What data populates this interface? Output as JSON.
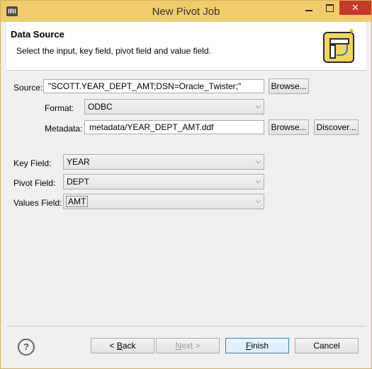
{
  "window": {
    "title": "New Pivot Job",
    "app_icon_text": "IRI",
    "close_glyph": "✕"
  },
  "header": {
    "title": "Data Source",
    "description": "Select the input, key field, pivot field and value field.",
    "icon": "pivot-wizard-icon"
  },
  "source": {
    "label": "Source:",
    "value": "\"SCOTT.YEAR_DEPT_AMT;DSN=Oracle_Twister;\"",
    "browse_label": "Browse..."
  },
  "format": {
    "label": "Format:",
    "value": "ODBC"
  },
  "metadata": {
    "label": "Metadata:",
    "value": "metadata/YEAR_DEPT_AMT.ddf",
    "browse_label": "Browse...",
    "discover_label": "Discover..."
  },
  "key_field": {
    "label": "Key Field:",
    "value": "YEAR"
  },
  "pivot_field": {
    "label": "Pivot Field:",
    "value": "DEPT"
  },
  "values_field": {
    "label": "Values Field:",
    "value": "AMT"
  },
  "buttons": {
    "back_mnemonic": "B",
    "back_rest": "ack",
    "back_prefix": "< ",
    "next_prefix": "",
    "next_mnemonic": "N",
    "next_rest": "ext >",
    "finish_mnemonic": "F",
    "finish_rest": "inish",
    "cancel": "Cancel"
  },
  "help_glyph": "?",
  "combo_glyph": "⌵"
}
